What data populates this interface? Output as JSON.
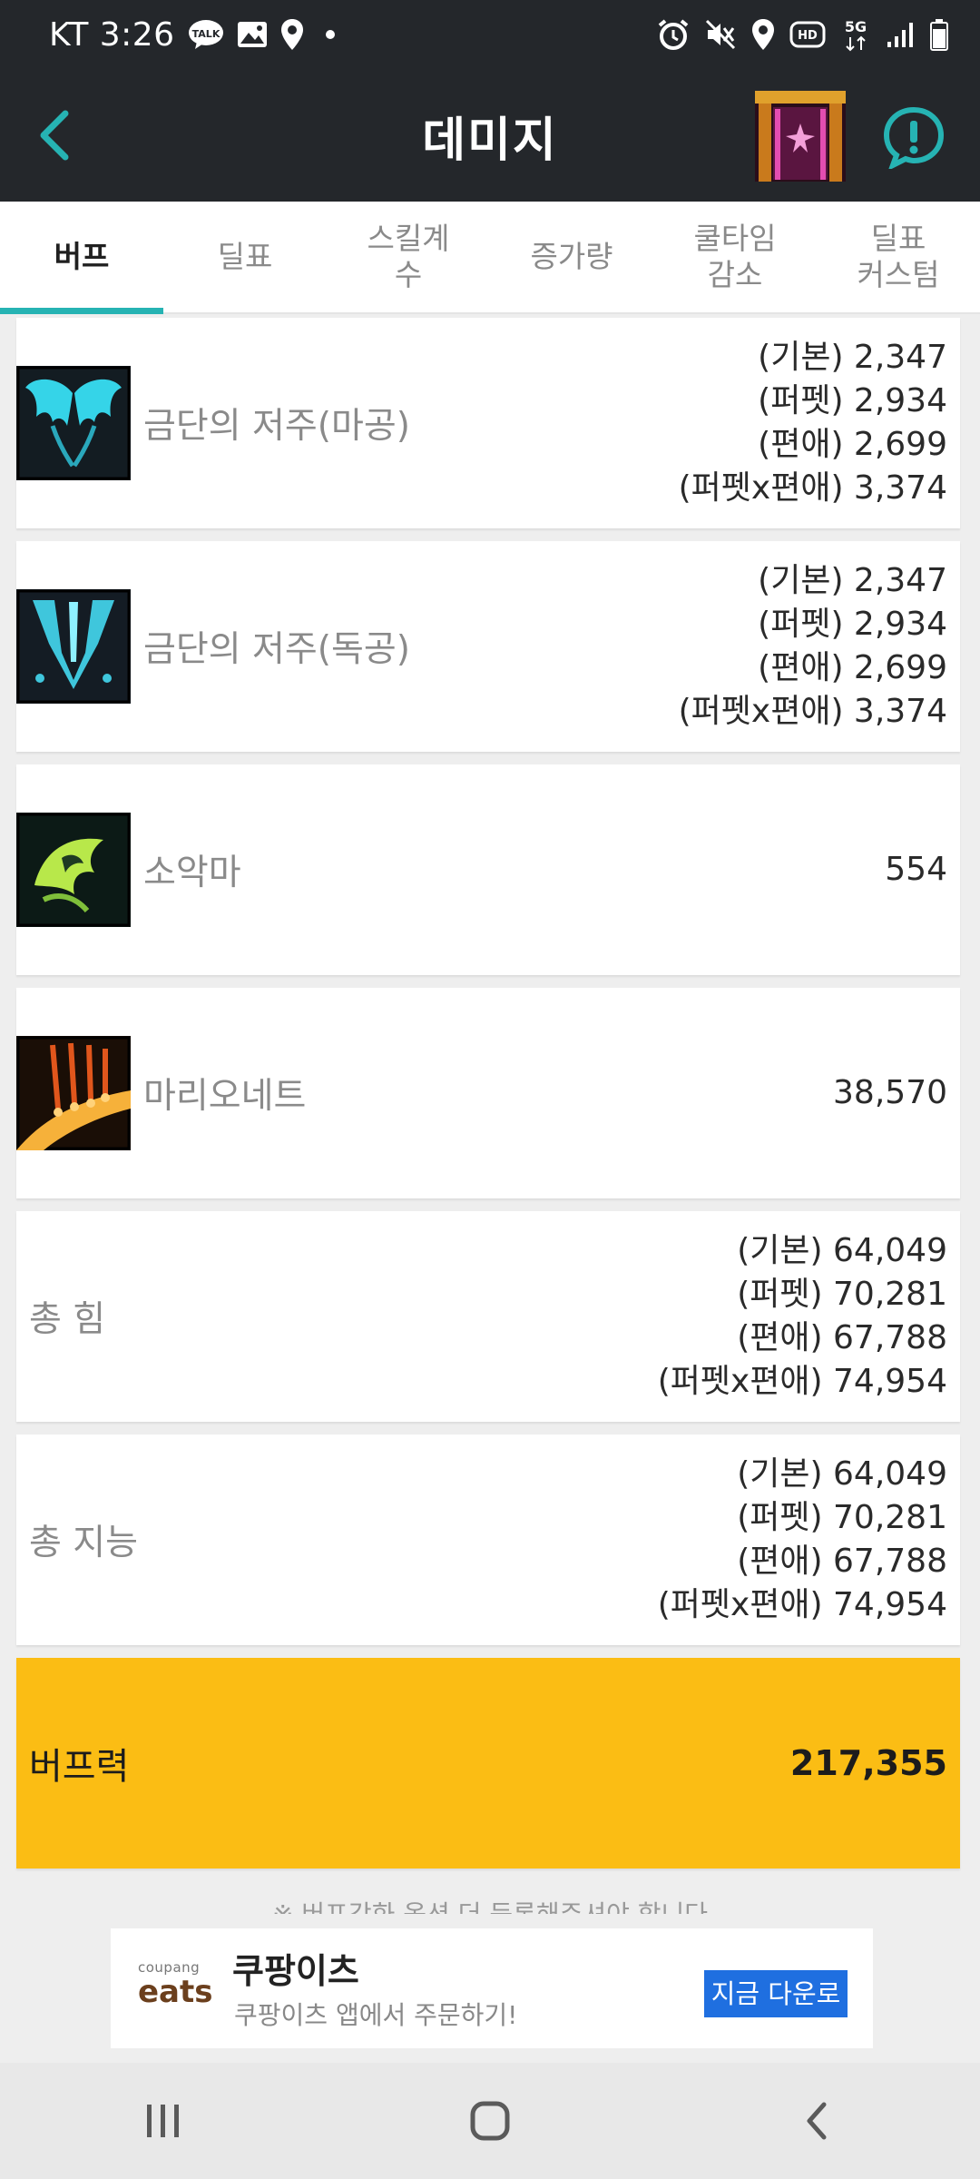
{
  "status_bar": {
    "carrier_time": "KT 3:26",
    "talk_badge": "TALK",
    "hd_badge": "HD",
    "net_badge": "5G",
    "icons_left": [
      "talk-icon",
      "image-icon",
      "location-icon",
      "dot-icon"
    ],
    "icons_right": [
      "alarm-icon",
      "mute-icon",
      "location-icon",
      "hd-icon",
      "5g-icon",
      "signal-icon",
      "battery-icon"
    ]
  },
  "app_bar": {
    "title": "데미지",
    "back_icon": "chevron-left-icon",
    "alert_icon": "alert-circle-icon",
    "accent_color": "#26b3b3"
  },
  "tabs": [
    {
      "label": "버프",
      "active": true
    },
    {
      "label": "딜표",
      "active": false
    },
    {
      "label": "스킬계\n수",
      "active": false
    },
    {
      "label": "증가량",
      "active": false
    },
    {
      "label": "쿨타임\n감소",
      "active": false
    },
    {
      "label": "딜표\n커스텀",
      "active": false
    }
  ],
  "rows": [
    {
      "name": "금단의 저주(마공)",
      "icon": "wings-skill-icon",
      "values": [
        "(기본) 2,347",
        "(퍼펫) 2,934",
        "(편애) 2,699",
        "(퍼펫x편애) 3,374"
      ]
    },
    {
      "name": "금단의 저주(독공)",
      "icon": "blade-skill-icon",
      "values": [
        "(기본) 2,347",
        "(퍼펫) 2,934",
        "(편애) 2,699",
        "(퍼펫x편애) 3,374"
      ]
    },
    {
      "name": "소악마",
      "icon": "imp-skill-icon",
      "values": [
        "554"
      ]
    },
    {
      "name": "마리오네트",
      "icon": "marionette-skill-icon",
      "values": [
        "38,570"
      ]
    },
    {
      "name": "총 힘",
      "icon": null,
      "values": [
        "(기본) 64,049",
        "(퍼펫) 70,281",
        "(편애) 67,788",
        "(퍼펫x편애) 74,954"
      ]
    },
    {
      "name": "총 지능",
      "icon": null,
      "values": [
        "(기본) 64,049",
        "(퍼펫) 70,281",
        "(편애) 67,788",
        "(퍼펫x편애) 74,954"
      ]
    }
  ],
  "total": {
    "label": "버프력",
    "value": "217,355",
    "color": "#fbbd14"
  },
  "footnote": "※ 버프강화 옵션 더 등록해주셔야 합니다",
  "ad": {
    "logo_top": "coupang",
    "logo_bottom": "eats",
    "title": "쿠팡이츠",
    "subtitle": "쿠팡이츠 앱에서 주문하기!",
    "button": "지금 다운로"
  },
  "nav_bar": {
    "icons": [
      "recent-apps-icon",
      "home-icon",
      "back-icon"
    ]
  }
}
